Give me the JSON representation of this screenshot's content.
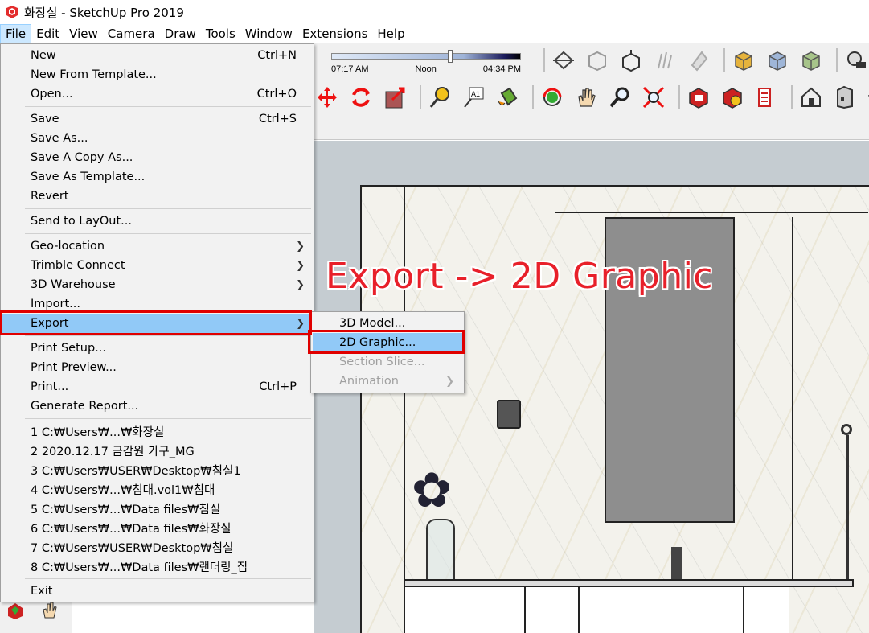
{
  "window": {
    "title": "화장실 - SketchUp Pro 2019"
  },
  "menubar": [
    "File",
    "Edit",
    "View",
    "Camera",
    "Draw",
    "Tools",
    "Window",
    "Extensions",
    "Help"
  ],
  "shadow": {
    "start_time": "07:17 AM",
    "mid_time": "Noon",
    "end_time": "04:34 PM"
  },
  "annotation": "Export -> 2D Graphic",
  "file_menu": {
    "new": {
      "label": "New",
      "shortcut": "Ctrl+N"
    },
    "new_from_template": {
      "label": "New From Template..."
    },
    "open": {
      "label": "Open...",
      "shortcut": "Ctrl+O"
    },
    "save": {
      "label": "Save",
      "shortcut": "Ctrl+S"
    },
    "save_as": {
      "label": "Save As..."
    },
    "save_copy_as": {
      "label": "Save A Copy As..."
    },
    "save_as_template": {
      "label": "Save As Template..."
    },
    "revert": {
      "label": "Revert"
    },
    "send_to_layout": {
      "label": "Send to LayOut..."
    },
    "geo_location": {
      "label": "Geo-location"
    },
    "trimble_connect": {
      "label": "Trimble Connect"
    },
    "warehouse": {
      "label": "3D Warehouse"
    },
    "import": {
      "label": "Import..."
    },
    "export": {
      "label": "Export"
    },
    "print_setup": {
      "label": "Print Setup..."
    },
    "print_preview": {
      "label": "Print Preview..."
    },
    "print": {
      "label": "Print...",
      "shortcut": "Ctrl+P"
    },
    "generate_report": {
      "label": "Generate Report..."
    },
    "recent": [
      "1 C:₩Users₩...₩화장실",
      "2 2020.12.17 금감원 가구_MG",
      "3 C:₩Users₩USER₩Desktop₩침실1",
      "4 C:₩Users₩...₩침대.vol1₩침대",
      "5 C:₩Users₩...₩Data files₩침실",
      "6 C:₩Users₩...₩Data files₩화장실",
      "7 C:₩Users₩USER₩Desktop₩침실",
      "8 C:₩Users₩...₩Data files₩랜더링_집"
    ],
    "exit": {
      "label": "Exit"
    }
  },
  "export_submenu": {
    "model": "3D Model...",
    "graphic": "2D Graphic...",
    "section": "Section Slice...",
    "animation": "Animation"
  },
  "colors": {
    "highlight": "#91c9f7",
    "annotation": "#e8202a",
    "redbox": "#e00000"
  }
}
